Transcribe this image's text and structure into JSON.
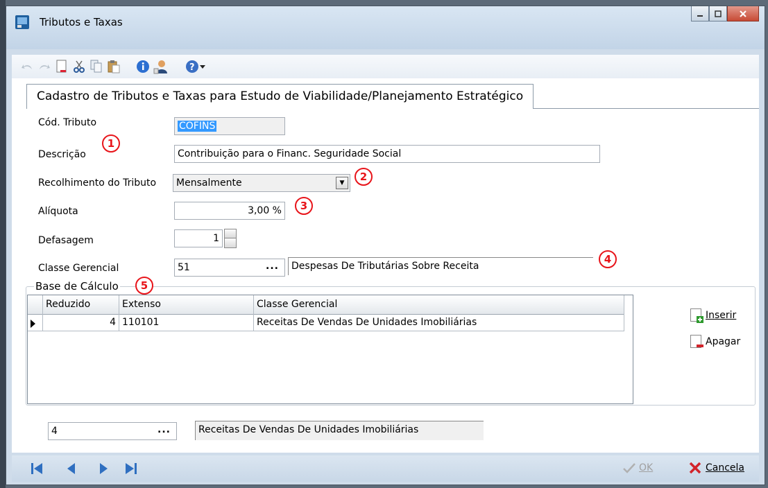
{
  "window": {
    "title": "Tributos e Taxas"
  },
  "tab": {
    "label": "Cadastro de Tributos e Taxas para Estudo de Viabilidade/Planejamento Estratégico"
  },
  "form": {
    "cod_tributo": {
      "label": "Cód. Tributo",
      "value": "COFINS"
    },
    "descricao": {
      "label": "Descrição",
      "value": "Contribuição para o Financ. Seguridade Social"
    },
    "recolhimento": {
      "label": "Recolhimento do Tributo",
      "value": "Mensalmente"
    },
    "aliquota": {
      "label": "Alíquota",
      "value": "3,00 %"
    },
    "defasagem": {
      "label": "Defasagem",
      "value": "1"
    },
    "classe_gerencial": {
      "label": "Classe Gerencial",
      "code": "51",
      "description": "Despesas De Tributárias Sobre Receita",
      "lookup": "..."
    }
  },
  "markers": [
    "1",
    "2",
    "3",
    "4",
    "5"
  ],
  "base_calculo": {
    "legend": "Base de Cálculo",
    "columns": [
      "Reduzido",
      "Extenso",
      "Classe Gerencial"
    ],
    "rows": [
      {
        "reduzido": "4",
        "extenso": "110101",
        "classe": "Receitas De Vendas De Unidades Imobiliárias"
      }
    ],
    "insert_label": "Inserir",
    "delete_label": "Apagar"
  },
  "bottom_lookup": {
    "code": "4",
    "lookup": "...",
    "description": "Receitas De Vendas De Unidades Imobiliárias"
  },
  "footer": {
    "ok_label": "OK",
    "cancel_label": "Cancela"
  },
  "icons": [
    "app-icon",
    "undo-icon",
    "redo-icon",
    "new-icon",
    "cut-icon",
    "copy-icon",
    "paste-icon",
    "info-icon",
    "user-icon",
    "help-icon",
    "first-icon",
    "prev-icon",
    "next-icon",
    "last-icon",
    "check-icon",
    "cancel-x-icon"
  ],
  "colors": {
    "marker": "#e8141a",
    "selection": "#3399ff",
    "nav": "#2f6fc0"
  }
}
